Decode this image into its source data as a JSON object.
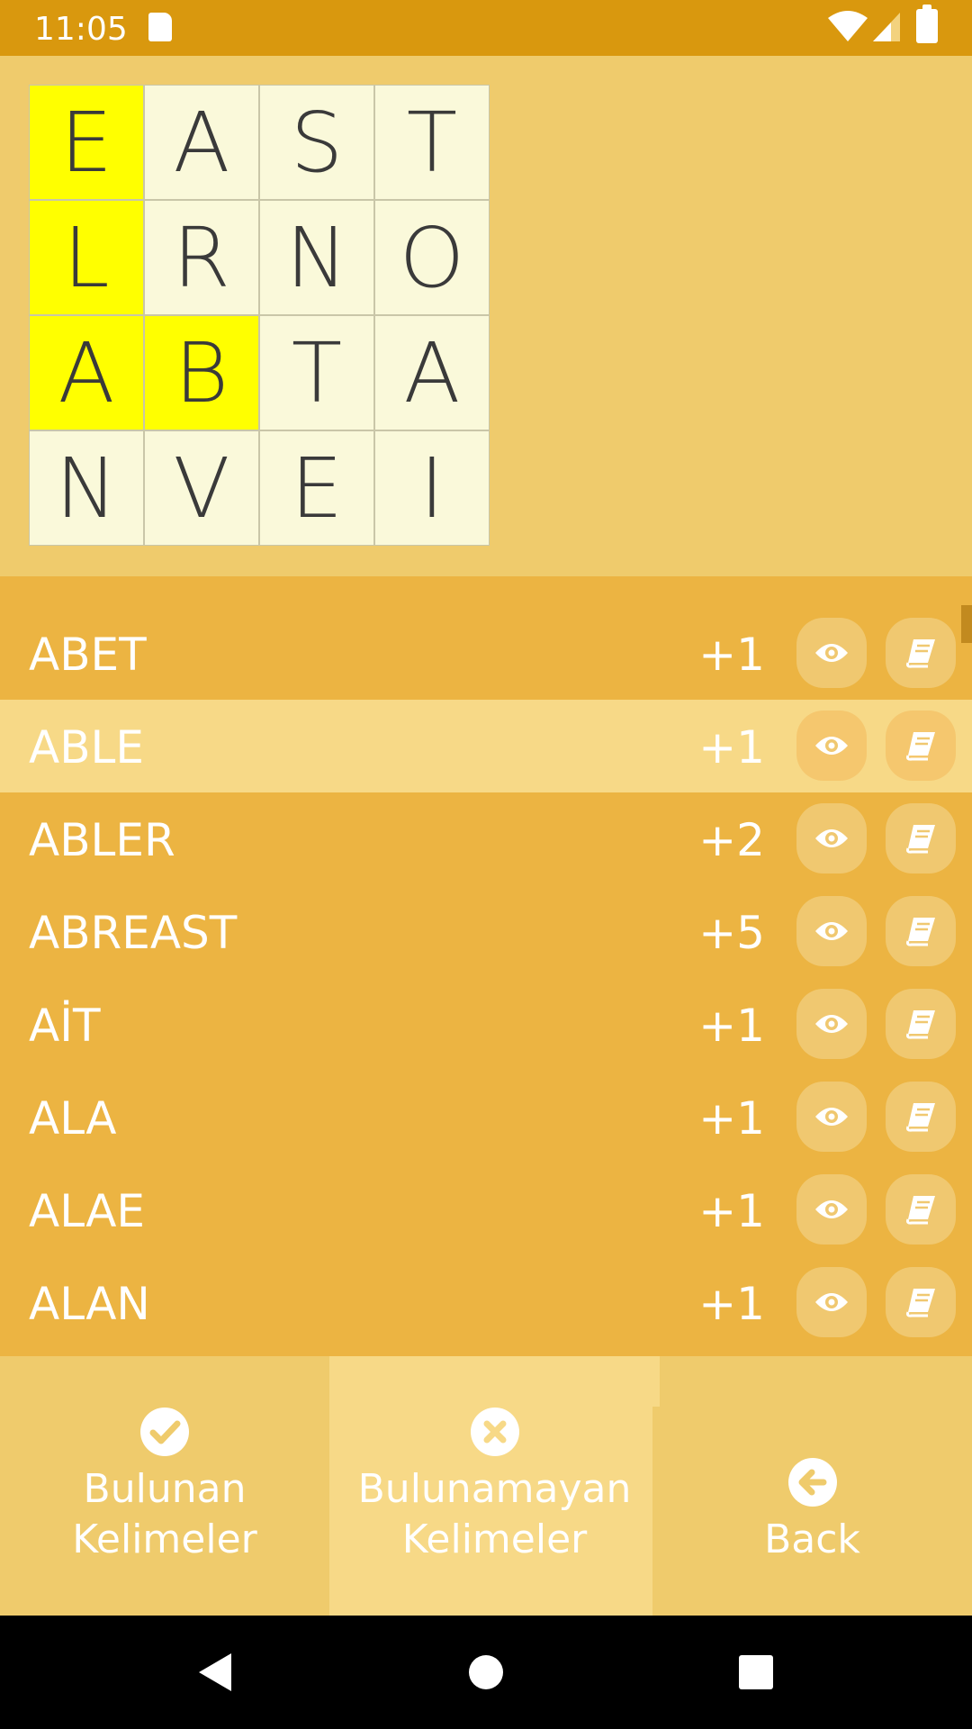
{
  "status_bar": {
    "time": "11:05"
  },
  "board": {
    "cells": [
      "E",
      "A",
      "S",
      "T",
      "L",
      "R",
      "N",
      "O",
      "A",
      "B",
      "T",
      "A",
      "N",
      "V",
      "E",
      "I"
    ],
    "highlighted": [
      0,
      4,
      8,
      9
    ],
    "highlight_color": "#FFFF00"
  },
  "word_list": {
    "selected_index": 1,
    "rows": [
      {
        "word": "ABET",
        "score": "+1"
      },
      {
        "word": "ABLE",
        "score": "+1"
      },
      {
        "word": "ABLER",
        "score": "+2"
      },
      {
        "word": "ABREAST",
        "score": "+5"
      },
      {
        "word": "AİT",
        "score": "+1"
      },
      {
        "word": "ALA",
        "score": "+1"
      },
      {
        "word": "ALAE",
        "score": "+1"
      },
      {
        "word": "ALAN",
        "score": "+1"
      }
    ],
    "row_icons": [
      "eye-icon",
      "book-icon"
    ]
  },
  "bottom_tabs": {
    "found": {
      "line1": "Bulunan",
      "line2": "Kelimeler",
      "icon": "check-circle-icon"
    },
    "missing": {
      "line1": "Bulunamayan",
      "line2": "Kelimeler",
      "icon": "x-circle-icon"
    },
    "back": {
      "label": "Back",
      "icon": "arrow-left-circle-icon"
    }
  },
  "colors": {
    "status_bar": "#D9980E",
    "list_bg": "#ECB442",
    "selected_row": "#F7D987",
    "board_bg": "#EFCB6C"
  }
}
